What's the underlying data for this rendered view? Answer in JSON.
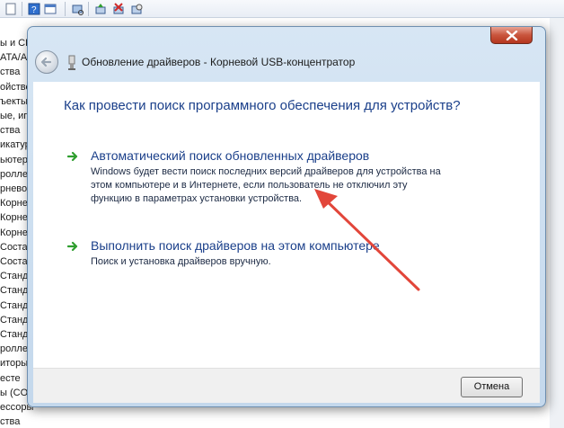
{
  "background": {
    "tree_items": [
      "ы и CD-",
      "ATA/A",
      "ства",
      "ойстве",
      "ъекты",
      "ые, иг",
      "ства",
      "икатур",
      "ьютер",
      "роллер",
      "рнево",
      "Корнев",
      "Корнев",
      "Корнев",
      "Состав",
      "Состав",
      "Станда",
      "Станда",
      "Станда",
      "Станда",
      "Станда",
      "роллер",
      "иторы",
      "есте",
      "ы (CO",
      "ессоры",
      "ства"
    ]
  },
  "dialog": {
    "title": "Обновление драйверов - Корневой USB-концентратор",
    "heading": "Как провести поиск программного обеспечения для устройств?",
    "options": [
      {
        "title": "Автоматический поиск обновленных драйверов",
        "description_lines": [
          "Windows будет вести поиск последних версий драйверов для устройства на",
          "этом компьютере и в Интернете, если пользователь не отключил эту",
          "функцию в параметрах установки устройства."
        ]
      },
      {
        "title": "Выполнить поиск драйверов на этом компьютере",
        "description_lines": [
          "Поиск и установка драйверов вручную."
        ]
      }
    ],
    "cancel_label": "Отмена"
  },
  "icons": {
    "back": "back-arrow-icon",
    "close": "close-icon",
    "device": "usb-hub-icon",
    "option": "green-arrow-icon"
  },
  "colors": {
    "link_blue": "#1a3f8a",
    "option_arrow": "#2f9e2f",
    "annotation_arrow": "#e2463a",
    "close_red": "#c9553d"
  }
}
